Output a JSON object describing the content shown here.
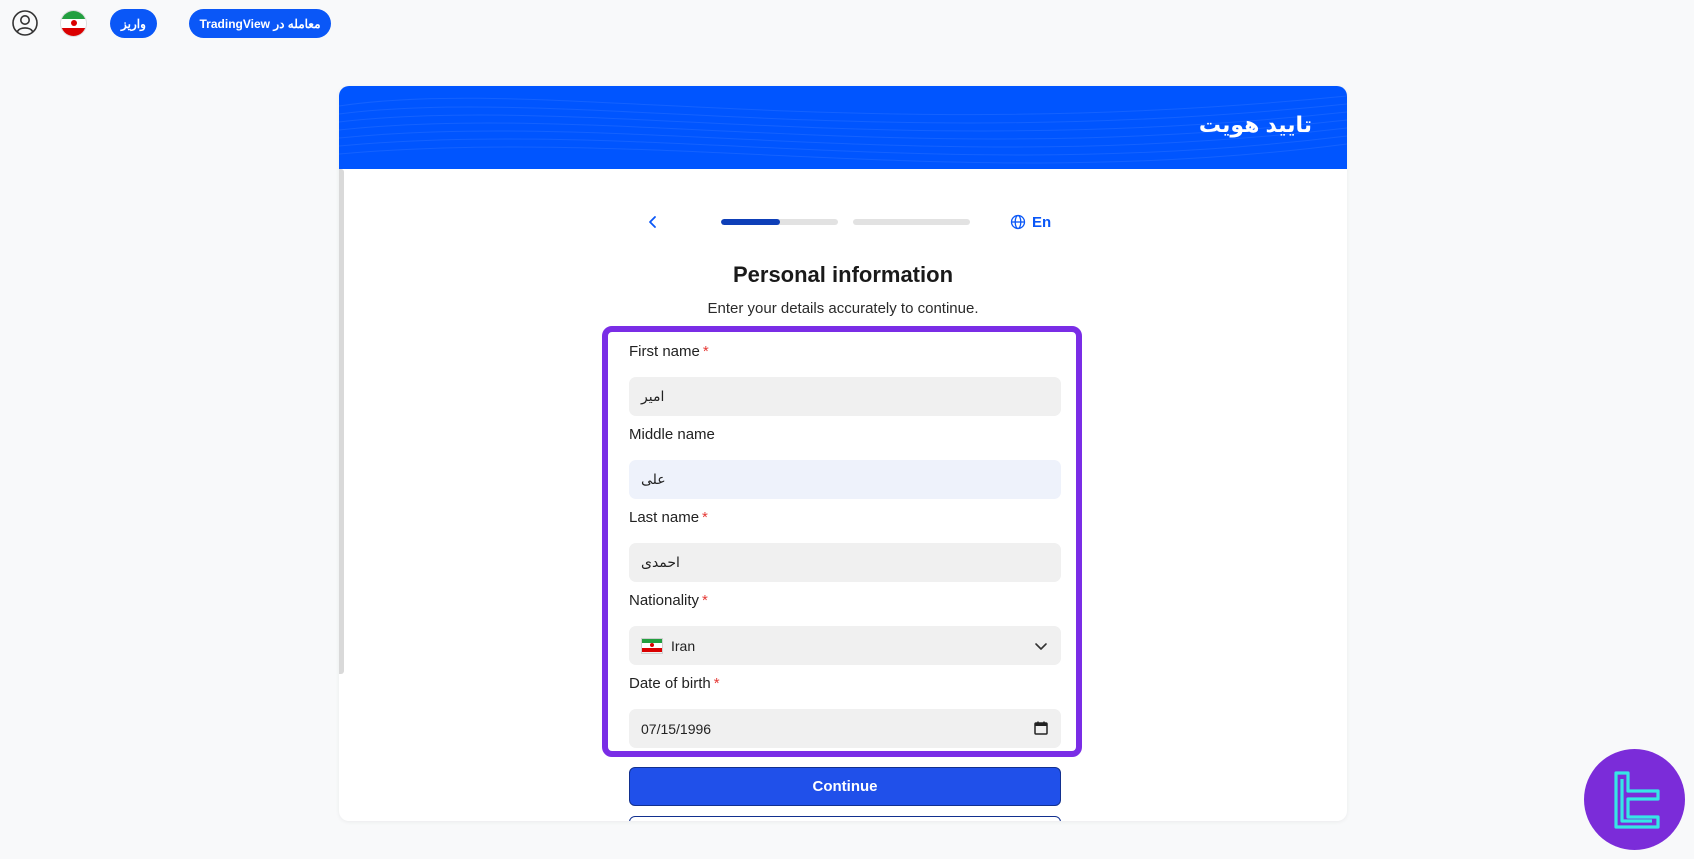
{
  "topbar": {
    "deposit_label": "واریز",
    "trade_label": "معامله در TradingView"
  },
  "header": {
    "title": "تایید هویت"
  },
  "steps": {
    "current_step": 1,
    "total_steps": 2,
    "step1_progress_pct": 50,
    "step2_progress_pct": 0,
    "language_label": "En"
  },
  "form": {
    "title": "Personal information",
    "subtitle": "Enter your details accurately to continue.",
    "fields": [
      {
        "label": "First name",
        "required_mark": "*",
        "value": "امیر"
      },
      {
        "label": "Middle name",
        "required_mark": "",
        "value": "علی"
      },
      {
        "label": "Last name",
        "required_mark": "*",
        "value": "احمدی"
      },
      {
        "label": "Nationality",
        "required_mark": "*",
        "value": "Iran"
      },
      {
        "label": "Date of birth",
        "required_mark": "*",
        "value": "07/15/1996"
      }
    ],
    "continue_label": "Continue"
  },
  "colors": {
    "primary": "#0055ff",
    "highlight": "#7a2de6",
    "progress": "#0e3fb8",
    "required": "#e53935"
  },
  "icons": {
    "user": "user-circle-icon",
    "back": "chevron-left-icon",
    "language": "globe-icon",
    "dropdown": "chevron-down-icon",
    "calendar": "calendar-icon",
    "logo": "brand-logo"
  }
}
